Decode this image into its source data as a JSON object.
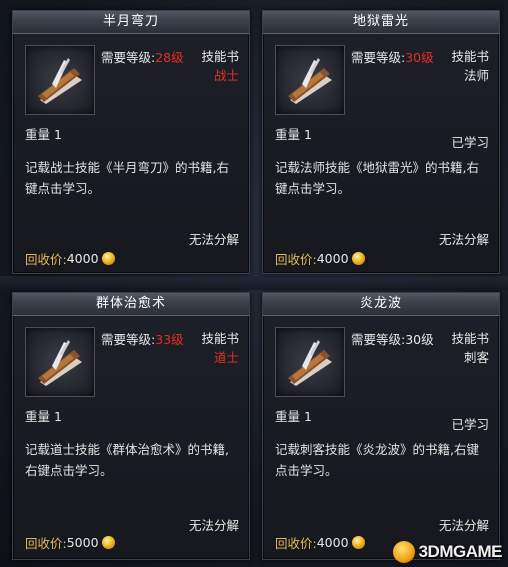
{
  "cards": [
    {
      "title": "半月弯刀",
      "req_label": "需要等级:",
      "req_level": "28级",
      "type": "技能书",
      "class": "战士",
      "weight": "重量 1",
      "learned": "",
      "desc": "记载战士技能《半月弯刀》的书籍,右键点击学习。",
      "no_decompose": "无法分解",
      "price_label": "回收价:",
      "price": "4000"
    },
    {
      "title": "地狱雷光",
      "req_label": "需要等级:",
      "req_level": "30级",
      "type": "技能书",
      "class": "法师",
      "weight": "重量 1",
      "learned": "已学习",
      "desc": "记载法师技能《地狱雷光》的书籍,右键点击学习。",
      "no_decompose": "无法分解",
      "price_label": "回收价:",
      "price": "4000"
    },
    {
      "title": "群体治愈术",
      "req_label": "需要等级:",
      "req_level": "33级",
      "type": "技能书",
      "class": "道士",
      "weight": "重量 1",
      "learned": "",
      "desc": "记载道士技能《群体治愈术》的书籍,右键点击学习。",
      "no_decompose": "无法分解",
      "price_label": "回收价:",
      "price": "5000"
    },
    {
      "title": "炎龙波",
      "req_label": "需要等级:",
      "req_level": "30级",
      "type": "技能书",
      "class": "刺客",
      "weight": "重量 1",
      "learned": "已学习",
      "desc": "记载刺客技能《炎龙波》的书籍,右键点击学习。",
      "no_decompose": "无法分解",
      "price_label": "回收价:",
      "price": "4000"
    }
  ],
  "colors": {
    "warning": "#e62d22",
    "price_label": "#e2b85a"
  },
  "icons": {
    "item": "skill-book-icon",
    "coin": "gold-coin-icon"
  },
  "watermark": "3DMGAME"
}
